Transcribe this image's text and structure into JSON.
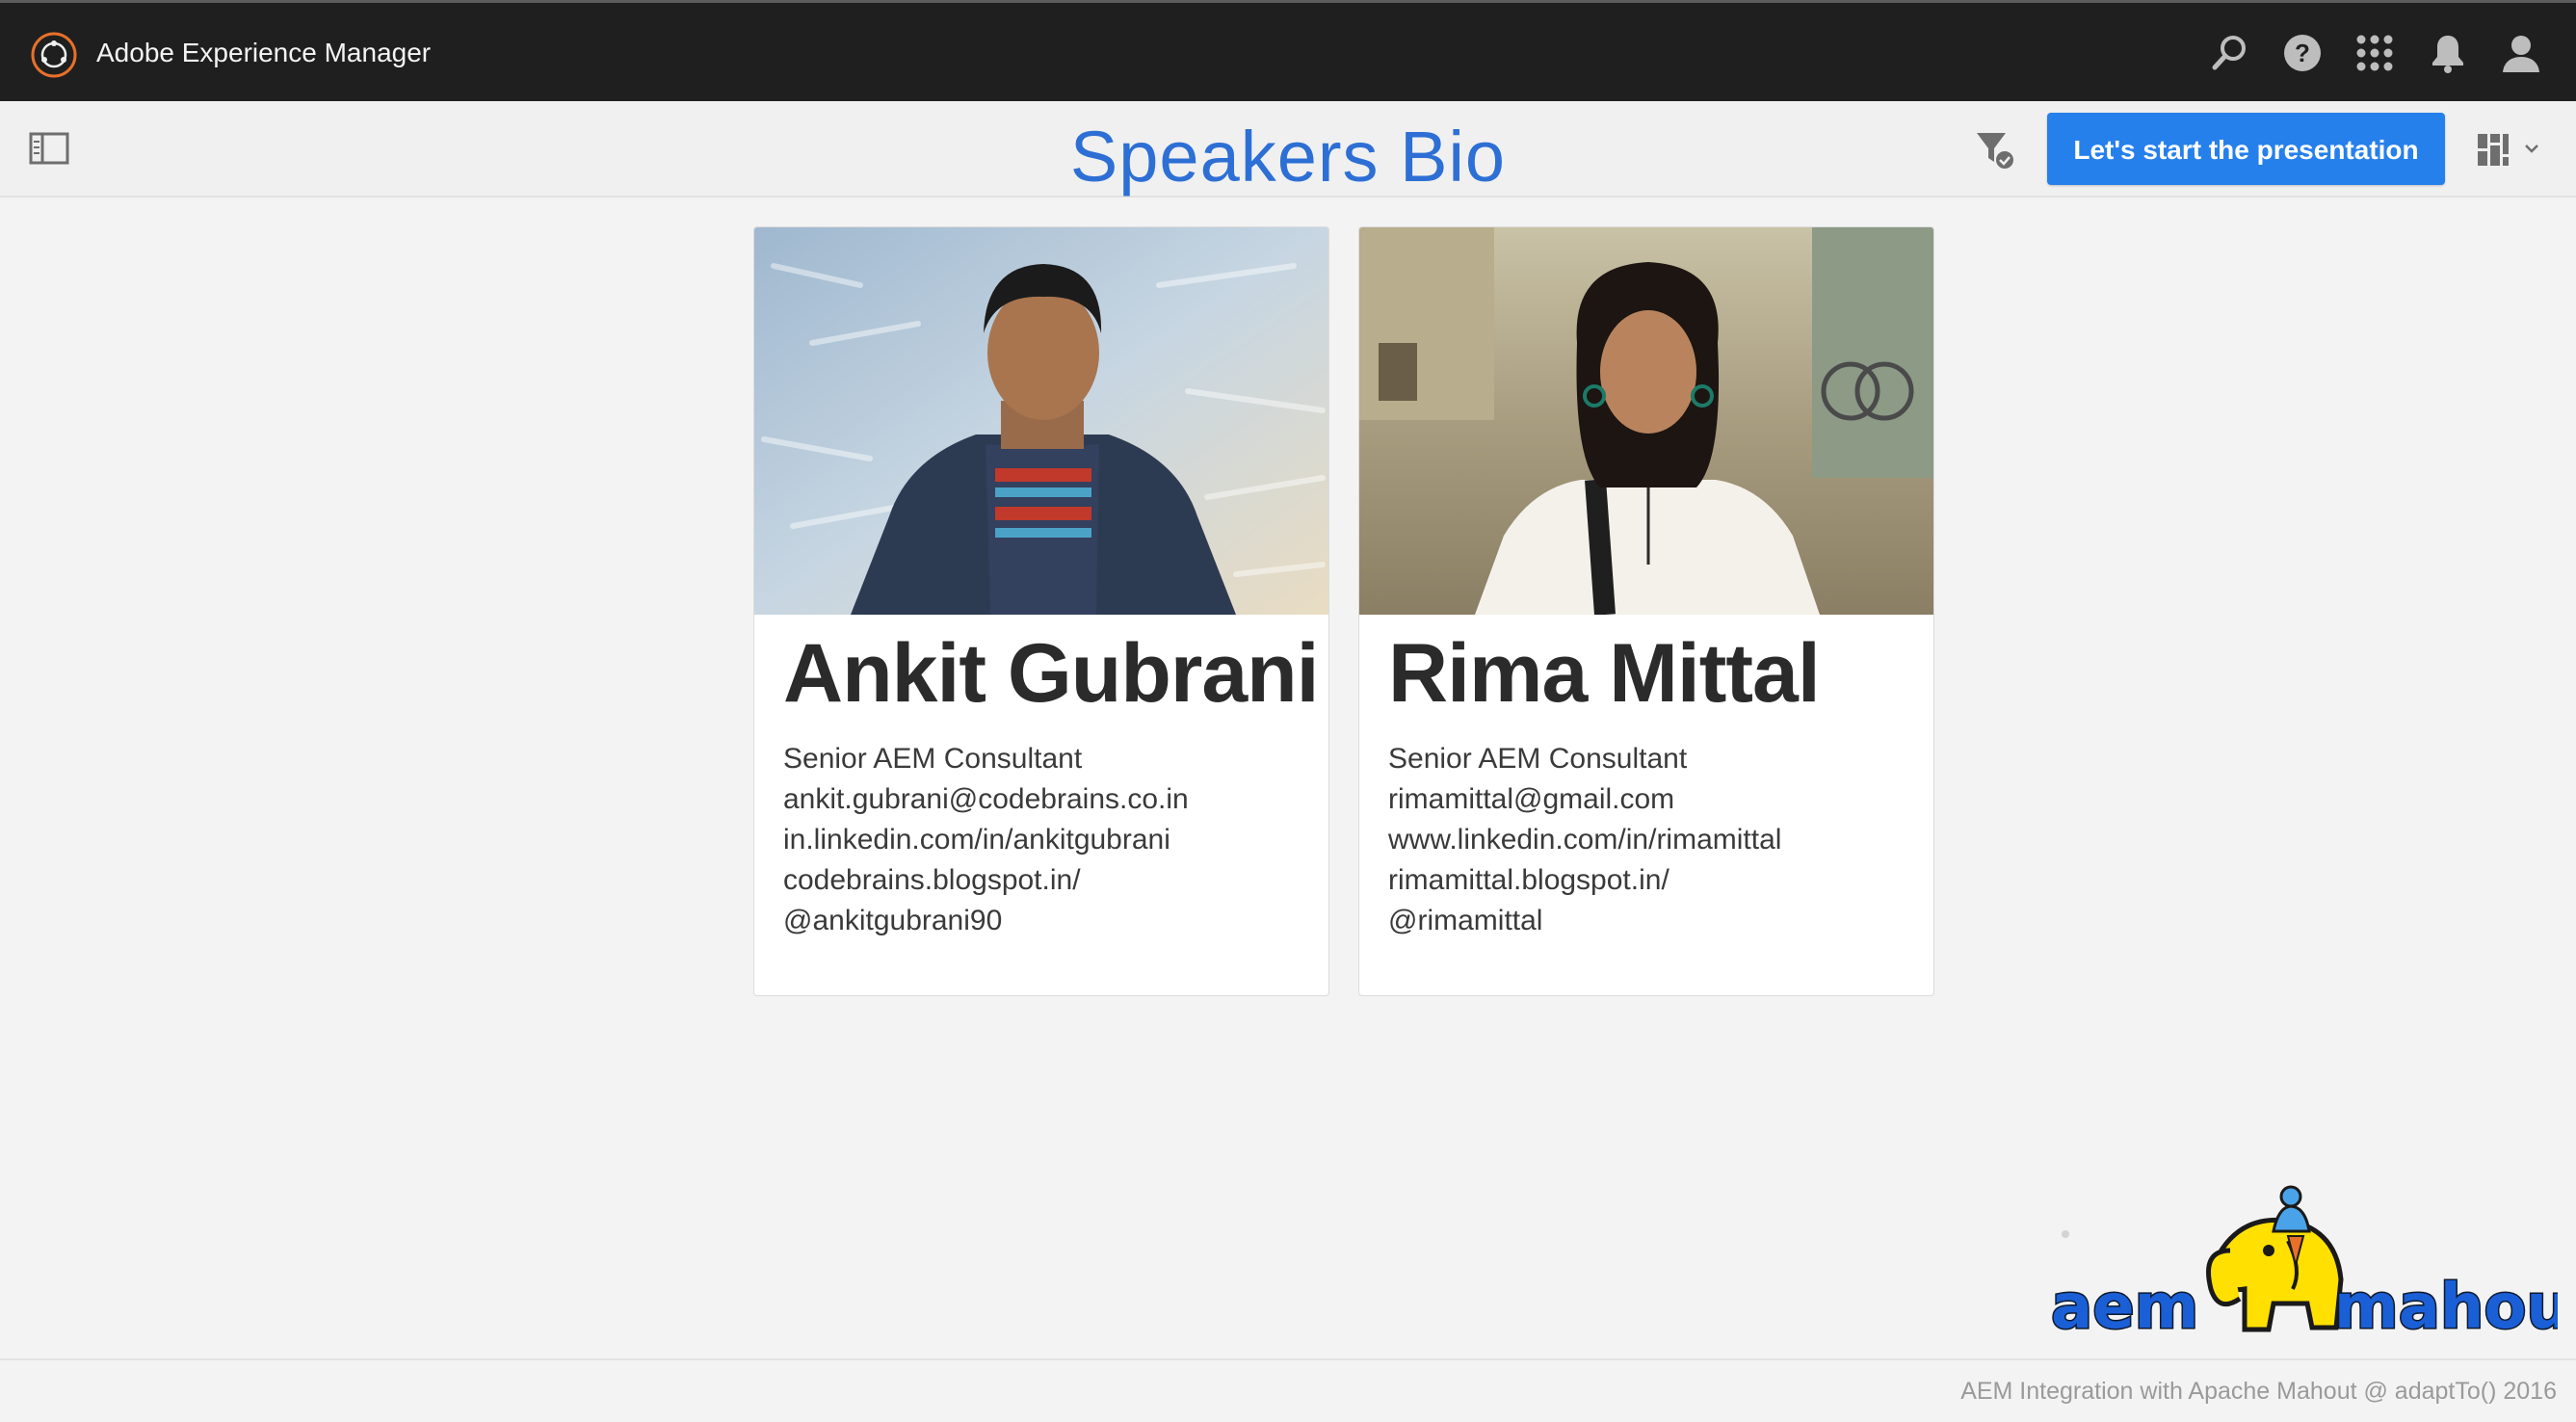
{
  "shell": {
    "title": "Adobe Experience Manager",
    "icons": [
      "search-icon",
      "help-icon",
      "apps-grid-icon",
      "bell-icon",
      "user-icon"
    ]
  },
  "actionbar": {
    "page_title": "Speakers Bio",
    "primary_button": "Let's start the presentation",
    "icons": [
      "rail-toggle-icon",
      "filter-check-icon",
      "card-view-icon",
      "chevron-down-icon"
    ]
  },
  "speakers": [
    {
      "name": "Ankit Gubrani",
      "role": "Senior AEM Consultant",
      "email": "ankit.gubrani@codebrains.co.in",
      "linkedin": "in.linkedin.com/in/ankitgubrani",
      "blog": "codebrains.blogspot.in/",
      "twitter": "@ankitgubrani90"
    },
    {
      "name": "Rima Mittal",
      "role": "Senior AEM Consultant",
      "email": "rimamittal@gmail.com",
      "linkedin": "www.linkedin.com/in/rimamittal",
      "blog": "rimamittal.blogspot.in/",
      "twitter": "@rimamittal"
    }
  ],
  "logo": {
    "left_word": "aem",
    "right_word": "mahout"
  },
  "footer": {
    "text": "AEM Integration with Apache Mahout @ adaptTo() 2016"
  },
  "colors": {
    "accent": "#2d6fd4",
    "button": "#2680eb",
    "shell": "#1f1f1f",
    "brand_orange": "#e8702a",
    "logo_blue": "#1a5fd6",
    "logo_yellow": "#ffe000"
  }
}
